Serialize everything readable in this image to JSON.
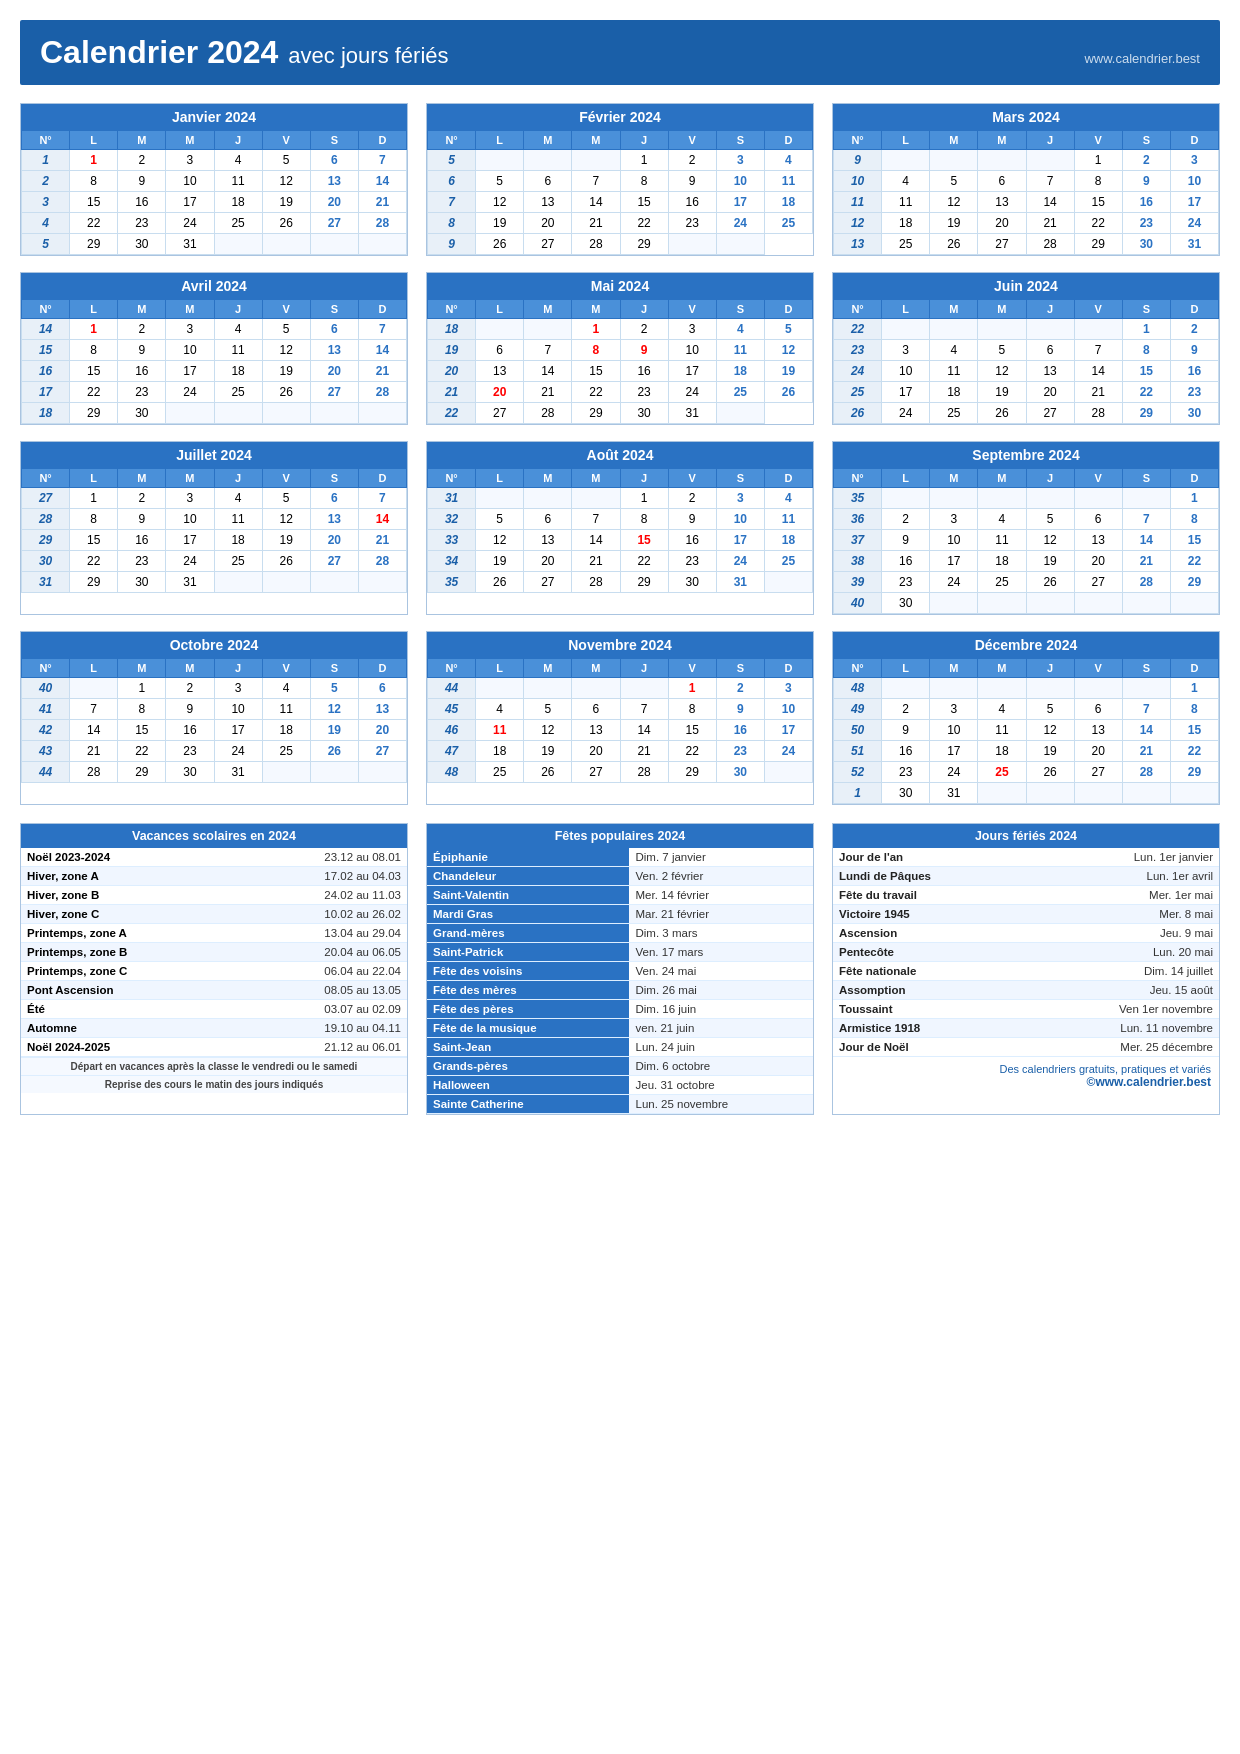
{
  "header": {
    "title_main": "Calendrier 2024",
    "title_sub": "avec jours fériés",
    "website": "www.calendrier.best"
  },
  "months": [
    {
      "name": "Janvier 2024",
      "weeks": [
        {
          "num": "N°",
          "days": [
            "L",
            "M",
            "M",
            "J",
            "V",
            "S",
            "D"
          ]
        },
        {
          "num": "1",
          "days": [
            "1",
            "2",
            "3",
            "4",
            "5",
            "6",
            "7"
          ]
        },
        {
          "num": "2",
          "days": [
            "8",
            "9",
            "10",
            "11",
            "12",
            "13",
            "14"
          ]
        },
        {
          "num": "3",
          "days": [
            "15",
            "16",
            "17",
            "18",
            "19",
            "20",
            "21"
          ]
        },
        {
          "num": "4",
          "days": [
            "22",
            "23",
            "24",
            "25",
            "26",
            "27",
            "28"
          ]
        },
        {
          "num": "5",
          "days": [
            "29",
            "30",
            "31",
            "",
            "",
            "",
            ""
          ]
        }
      ]
    },
    {
      "name": "Février 2024",
      "weeks": [
        {
          "num": "N°",
          "days": [
            "L",
            "M",
            "M",
            "J",
            "V",
            "S",
            "D"
          ]
        },
        {
          "num": "5",
          "days": [
            "",
            "",
            "",
            "1",
            "2",
            "3",
            "4"
          ]
        },
        {
          "num": "6",
          "days": [
            "5",
            "6",
            "7",
            "8",
            "9",
            "10",
            "11"
          ]
        },
        {
          "num": "7",
          "days": [
            "12",
            "13",
            "14",
            "15",
            "16",
            "17",
            "18"
          ]
        },
        {
          "num": "8",
          "days": [
            "19",
            "20",
            "21",
            "22",
            "23",
            "24",
            "25"
          ]
        },
        {
          "num": "9",
          "days": [
            "26",
            "27",
            "28",
            "29",
            "",
            ""
          ]
        }
      ]
    },
    {
      "name": "Mars 2024",
      "weeks": [
        {
          "num": "N°",
          "days": [
            "L",
            "M",
            "M",
            "J",
            "V",
            "S",
            "D"
          ]
        },
        {
          "num": "9",
          "days": [
            "",
            "",
            "",
            "",
            "1",
            "2",
            "3"
          ]
        },
        {
          "num": "10",
          "days": [
            "4",
            "5",
            "6",
            "7",
            "8",
            "9",
            "10"
          ]
        },
        {
          "num": "11",
          "days": [
            "11",
            "12",
            "13",
            "14",
            "15",
            "16",
            "17"
          ]
        },
        {
          "num": "12",
          "days": [
            "18",
            "19",
            "20",
            "21",
            "22",
            "23",
            "24"
          ]
        },
        {
          "num": "13",
          "days": [
            "25",
            "26",
            "27",
            "28",
            "29",
            "30",
            "31"
          ]
        }
      ]
    },
    {
      "name": "Avril 2024",
      "weeks": [
        {
          "num": "N°",
          "days": [
            "L",
            "M",
            "M",
            "J",
            "V",
            "S",
            "D"
          ]
        },
        {
          "num": "14",
          "days": [
            "1",
            "2",
            "3",
            "4",
            "5",
            "6",
            "7"
          ]
        },
        {
          "num": "15",
          "days": [
            "8",
            "9",
            "10",
            "11",
            "12",
            "13",
            "14"
          ]
        },
        {
          "num": "16",
          "days": [
            "15",
            "16",
            "17",
            "18",
            "19",
            "20",
            "21"
          ]
        },
        {
          "num": "17",
          "days": [
            "22",
            "23",
            "24",
            "25",
            "26",
            "27",
            "28"
          ]
        },
        {
          "num": "18",
          "days": [
            "29",
            "30",
            "",
            "",
            "",
            "",
            ""
          ]
        }
      ]
    },
    {
      "name": "Mai 2024",
      "weeks": [
        {
          "num": "N°",
          "days": [
            "L",
            "M",
            "M",
            "J",
            "V",
            "S",
            "D"
          ]
        },
        {
          "num": "18",
          "days": [
            "",
            "",
            "1",
            "2",
            "3",
            "4",
            "5"
          ]
        },
        {
          "num": "19",
          "days": [
            "6",
            "7",
            "8",
            "9",
            "10",
            "11",
            "12"
          ]
        },
        {
          "num": "20",
          "days": [
            "13",
            "14",
            "15",
            "16",
            "17",
            "18",
            "19"
          ]
        },
        {
          "num": "21",
          "days": [
            "20",
            "21",
            "22",
            "23",
            "24",
            "25",
            "26"
          ]
        },
        {
          "num": "22",
          "days": [
            "27",
            "28",
            "29",
            "30",
            "31",
            ""
          ]
        }
      ]
    },
    {
      "name": "Juin 2024",
      "weeks": [
        {
          "num": "N°",
          "days": [
            "L",
            "M",
            "M",
            "J",
            "V",
            "S",
            "D"
          ]
        },
        {
          "num": "22",
          "days": [
            "",
            "",
            "",
            "",
            "",
            "1",
            "2"
          ]
        },
        {
          "num": "23",
          "days": [
            "3",
            "4",
            "5",
            "6",
            "7",
            "8",
            "9"
          ]
        },
        {
          "num": "24",
          "days": [
            "10",
            "11",
            "12",
            "13",
            "14",
            "15",
            "16"
          ]
        },
        {
          "num": "25",
          "days": [
            "17",
            "18",
            "19",
            "20",
            "21",
            "22",
            "23"
          ]
        },
        {
          "num": "26",
          "days": [
            "24",
            "25",
            "26",
            "27",
            "28",
            "29",
            "30"
          ]
        }
      ]
    },
    {
      "name": "Juillet 2024",
      "weeks": [
        {
          "num": "N°",
          "days": [
            "L",
            "M",
            "M",
            "J",
            "V",
            "S",
            "D"
          ]
        },
        {
          "num": "27",
          "days": [
            "1",
            "2",
            "3",
            "4",
            "5",
            "6",
            "7"
          ]
        },
        {
          "num": "28",
          "days": [
            "8",
            "9",
            "10",
            "11",
            "12",
            "13",
            "14"
          ]
        },
        {
          "num": "29",
          "days": [
            "15",
            "16",
            "17",
            "18",
            "19",
            "20",
            "21"
          ]
        },
        {
          "num": "30",
          "days": [
            "22",
            "23",
            "24",
            "25",
            "26",
            "27",
            "28"
          ]
        },
        {
          "num": "31",
          "days": [
            "29",
            "30",
            "31",
            "",
            "",
            "",
            ""
          ]
        }
      ]
    },
    {
      "name": "Août 2024",
      "weeks": [
        {
          "num": "N°",
          "days": [
            "L",
            "M",
            "M",
            "J",
            "V",
            "S",
            "D"
          ]
        },
        {
          "num": "31",
          "days": [
            "",
            "",
            "",
            "1",
            "2",
            "3",
            "4"
          ]
        },
        {
          "num": "32",
          "days": [
            "5",
            "6",
            "7",
            "8",
            "9",
            "10",
            "11"
          ]
        },
        {
          "num": "33",
          "days": [
            "12",
            "13",
            "14",
            "15",
            "16",
            "17",
            "18"
          ]
        },
        {
          "num": "34",
          "days": [
            "19",
            "20",
            "21",
            "22",
            "23",
            "24",
            "25"
          ]
        },
        {
          "num": "35",
          "days": [
            "26",
            "27",
            "28",
            "29",
            "30",
            "31",
            ""
          ]
        }
      ]
    },
    {
      "name": "Septembre 2024",
      "weeks": [
        {
          "num": "N°",
          "days": [
            "L",
            "M",
            "M",
            "J",
            "V",
            "S",
            "D"
          ]
        },
        {
          "num": "35",
          "days": [
            "",
            "",
            "",
            "",
            "",
            "",
            "1"
          ]
        },
        {
          "num": "36",
          "days": [
            "2",
            "3",
            "4",
            "5",
            "6",
            "7",
            "8"
          ]
        },
        {
          "num": "37",
          "days": [
            "9",
            "10",
            "11",
            "12",
            "13",
            "14",
            "15"
          ]
        },
        {
          "num": "38",
          "days": [
            "16",
            "17",
            "18",
            "19",
            "20",
            "21",
            "22"
          ]
        },
        {
          "num": "39",
          "days": [
            "23",
            "24",
            "25",
            "26",
            "27",
            "28",
            "29"
          ]
        },
        {
          "num": "40",
          "days": [
            "30",
            "",
            "",
            "",
            "",
            "",
            ""
          ]
        }
      ]
    },
    {
      "name": "Octobre 2024",
      "weeks": [
        {
          "num": "N°",
          "days": [
            "L",
            "M",
            "M",
            "J",
            "V",
            "S",
            "D"
          ]
        },
        {
          "num": "40",
          "days": [
            "",
            "1",
            "2",
            "3",
            "4",
            "5",
            "6"
          ]
        },
        {
          "num": "41",
          "days": [
            "7",
            "8",
            "9",
            "10",
            "11",
            "12",
            "13"
          ]
        },
        {
          "num": "42",
          "days": [
            "14",
            "15",
            "16",
            "17",
            "18",
            "19",
            "20"
          ]
        },
        {
          "num": "43",
          "days": [
            "21",
            "22",
            "23",
            "24",
            "25",
            "26",
            "27"
          ]
        },
        {
          "num": "44",
          "days": [
            "28",
            "29",
            "30",
            "31",
            "",
            "",
            ""
          ]
        }
      ]
    },
    {
      "name": "Novembre 2024",
      "weeks": [
        {
          "num": "N°",
          "days": [
            "L",
            "M",
            "M",
            "J",
            "V",
            "S",
            "D"
          ]
        },
        {
          "num": "44",
          "days": [
            "",
            "",
            "",
            "",
            "1",
            "2",
            "3"
          ]
        },
        {
          "num": "45",
          "days": [
            "4",
            "5",
            "6",
            "7",
            "8",
            "9",
            "10"
          ]
        },
        {
          "num": "46",
          "days": [
            "11",
            "12",
            "13",
            "14",
            "15",
            "16",
            "17"
          ]
        },
        {
          "num": "47",
          "days": [
            "18",
            "19",
            "20",
            "21",
            "22",
            "23",
            "24"
          ]
        },
        {
          "num": "48",
          "days": [
            "25",
            "26",
            "27",
            "28",
            "29",
            "30",
            ""
          ]
        }
      ]
    },
    {
      "name": "Décembre 2024",
      "weeks": [
        {
          "num": "N°",
          "days": [
            "L",
            "M",
            "M",
            "J",
            "V",
            "S",
            "D"
          ]
        },
        {
          "num": "48",
          "days": [
            "",
            "",
            "",
            "",
            "",
            "",
            "1"
          ]
        },
        {
          "num": "49",
          "days": [
            "2",
            "3",
            "4",
            "5",
            "6",
            "7",
            "8"
          ]
        },
        {
          "num": "50",
          "days": [
            "9",
            "10",
            "11",
            "12",
            "13",
            "14",
            "15"
          ]
        },
        {
          "num": "51",
          "days": [
            "16",
            "17",
            "18",
            "19",
            "20",
            "21",
            "22"
          ]
        },
        {
          "num": "52",
          "days": [
            "23",
            "24",
            "25",
            "26",
            "27",
            "28",
            "29"
          ]
        },
        {
          "num": "1",
          "days": [
            "30",
            "31",
            "",
            "",
            "",
            "",
            ""
          ]
        }
      ]
    }
  ],
  "vacances": {
    "title": "Vacances scolaires en 2024",
    "items": [
      {
        "label": "Noël 2023-2024",
        "value": "23.12 au 08.01"
      },
      {
        "label": "Hiver, zone A",
        "value": "17.02 au 04.03"
      },
      {
        "label": "Hiver, zone B",
        "value": "24.02 au 11.03"
      },
      {
        "label": "Hiver, zone C",
        "value": "10.02 au 26.02"
      },
      {
        "label": "Printemps, zone A",
        "value": "13.04 au 29.04"
      },
      {
        "label": "Printemps, zone B",
        "value": "20.04 au 06.05"
      },
      {
        "label": "Printemps, zone C",
        "value": "06.04 au 22.04"
      },
      {
        "label": "Pont Ascension",
        "value": "08.05 au 13.05"
      },
      {
        "label": "Été",
        "value": "03.07 au 02.09"
      },
      {
        "label": "Automne",
        "value": "19.10 au 04.11"
      },
      {
        "label": "Noël 2024-2025",
        "value": "21.12 au 06.01"
      }
    ],
    "note1": "Départ en vacances après la classe le vendredi ou le samedi",
    "note2": "Reprise des cours le matin des jours indiqués"
  },
  "fetes": {
    "title": "Fêtes populaires 2024",
    "items": [
      {
        "label": "Épiphanie",
        "value": "Dim. 7 janvier"
      },
      {
        "label": "Chandeleur",
        "value": "Ven. 2 février"
      },
      {
        "label": "Saint-Valentin",
        "value": "Mer. 14 février"
      },
      {
        "label": "Mardi Gras",
        "value": "Mar. 21 février"
      },
      {
        "label": "Grand-mères",
        "value": "Dim. 3 mars"
      },
      {
        "label": "Saint-Patrick",
        "value": "Ven. 17 mars"
      },
      {
        "label": "Fête des voisins",
        "value": "Ven. 24 mai"
      },
      {
        "label": "Fête des mères",
        "value": "Dim. 26 mai"
      },
      {
        "label": "Fête des pères",
        "value": "Dim. 16 juin"
      },
      {
        "label": "Fête de la musique",
        "value": "ven. 21 juin"
      },
      {
        "label": "Saint-Jean",
        "value": "Lun. 24 juin"
      },
      {
        "label": "Grands-pères",
        "value": "Dim. 6 octobre"
      },
      {
        "label": "Halloween",
        "value": "Jeu. 31 octobre"
      },
      {
        "label": "Sainte Catherine",
        "value": "Lun. 25 novembre"
      }
    ]
  },
  "feries": {
    "title": "Jours fériés 2024",
    "items": [
      {
        "label": "Jour de l'an",
        "value": "Lun. 1er janvier"
      },
      {
        "label": "Lundi de Pâques",
        "value": "Lun. 1er avril"
      },
      {
        "label": "Fête du travail",
        "value": "Mer. 1er mai"
      },
      {
        "label": "Victoire 1945",
        "value": "Mer. 8 mai"
      },
      {
        "label": "Ascension",
        "value": "Jeu. 9 mai"
      },
      {
        "label": "Pentecôte",
        "value": "Lun. 20 mai"
      },
      {
        "label": "Fête nationale",
        "value": "Dim. 14 juillet"
      },
      {
        "label": "Assomption",
        "value": "Jeu. 15 août"
      },
      {
        "label": "Toussaint",
        "value": "Ven 1er novembre"
      },
      {
        "label": "Armistice 1918",
        "value": "Lun. 11 novembre"
      },
      {
        "label": "Jour de Noël",
        "value": "Mer. 25 décembre"
      }
    ]
  },
  "footer": {
    "brand_line1": "Des calendriers gratuits, pratiques et variés",
    "brand_line2": "©www.calendrier.best"
  }
}
